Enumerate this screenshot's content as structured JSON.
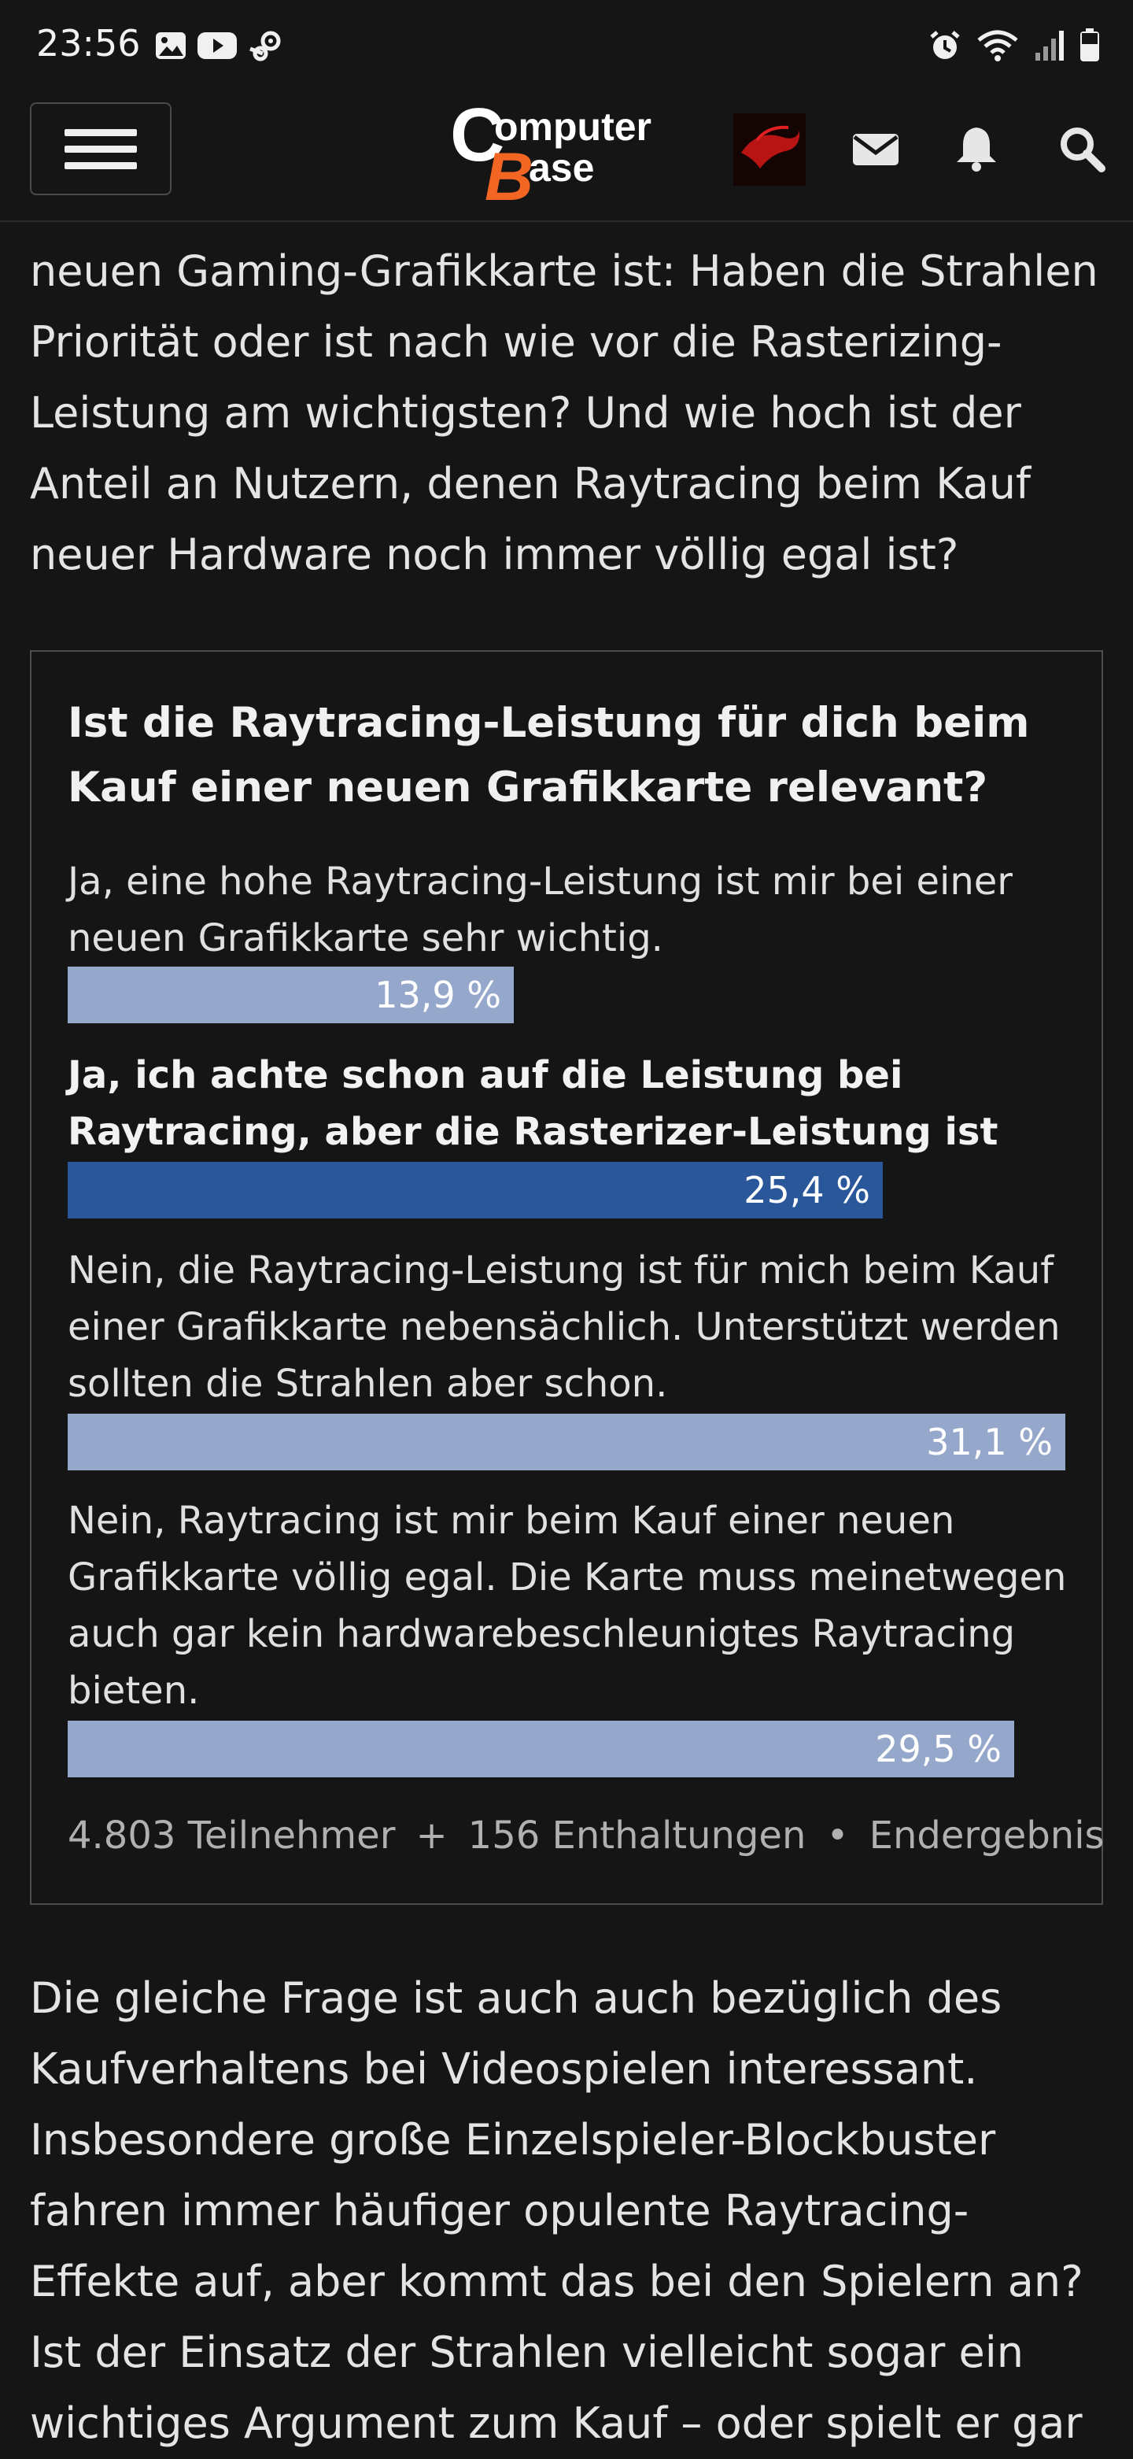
{
  "status_bar": {
    "time": "23:56",
    "left_icons": [
      "gallery-icon",
      "youtube-icon",
      "steam-icon"
    ],
    "right_icons": [
      "alarm-icon",
      "wifi-icon",
      "signal-icon",
      "battery-icon"
    ]
  },
  "header": {
    "logo_line1": "omputer",
    "logo_line2": "ase",
    "logo_c": "C",
    "logo_b": "B",
    "icons": [
      "menu-icon",
      "avatar",
      "mail-icon",
      "bell-icon",
      "search-icon"
    ]
  },
  "article": {
    "intro_lines": [
      "neuen Gaming-Grafikkarte ist: Haben die Strahlen",
      "Priorität oder ist nach wie vor die Rasterizing-",
      "Leistung am wichtigsten? Und wie hoch ist der",
      "Anteil an Nutzern, denen Raytracing beim Kauf",
      "neuer Hardware noch immer völlig egal ist?"
    ],
    "outro_lines": [
      "Die gleiche Frage ist auch auch bezüglich des",
      "Kaufverhaltens bei Videospielen interessant.",
      "Insbesondere große Einzelspieler-Blockbuster",
      "fahren immer häufiger opulente Raytracing-",
      "Effekte auf, aber kommt das bei den Spielern an?",
      "Ist der Einsatz der Strahlen vielleicht sogar ein",
      "wichtiges Argument zum Kauf – oder spielt er gar"
    ]
  },
  "poll": {
    "question": "Ist die Raytracing-Leistung für dich beim Kauf einer neuen Grafikkarte relevant?",
    "options": [
      {
        "label": "Ja, eine hohe Raytracing-Leistung ist mir bei einer neuen Grafikkarte sehr wichtig.",
        "percent_text": "13,9 %",
        "percent": 13.9,
        "selected": false
      },
      {
        "label": "Ja, ich achte schon auf die Leistung bei Raytracing, aber die Rasterizer-Leistung ist wichtiger.",
        "percent_text": "25,4 %",
        "percent": 25.4,
        "selected": true
      },
      {
        "label": "Nein, die Raytracing-Leistung ist für mich beim Kauf einer Grafikkarte nebensächlich. Unterstützt werden sollten die Strahlen aber schon.",
        "percent_text": "31,1 %",
        "percent": 31.1,
        "selected": false
      },
      {
        "label": "Nein, Raytracing ist mir beim Kauf einer neuen Grafikkarte völlig egal. Die Karte muss meinetwegen auch gar kein hardwarebeschleunigtes Raytracing bieten.",
        "percent_text": "29,5 %",
        "percent": 29.5,
        "selected": false
      }
    ],
    "footer": {
      "participants": "4.803 Teilnehmer",
      "plus": "+",
      "abstentions": "156 Enthaltungen",
      "dot": "•",
      "status": "Endergebnis"
    }
  },
  "colors": {
    "background": "#151515",
    "bar": "#95a8cb",
    "bar_selected": "#2a5799",
    "logo_orange": "#f26522"
  }
}
